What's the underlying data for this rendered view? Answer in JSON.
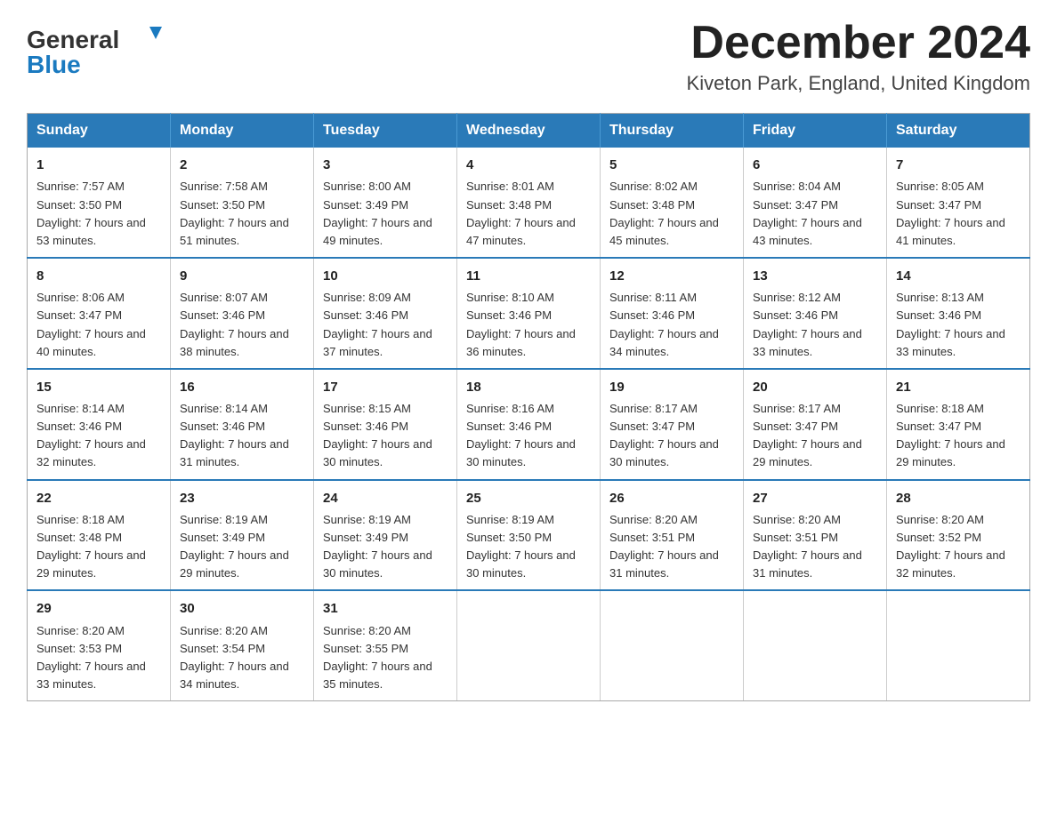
{
  "header": {
    "logo_general": "General",
    "logo_blue": "Blue",
    "month_title": "December 2024",
    "location": "Kiveton Park, England, United Kingdom"
  },
  "weekdays": [
    "Sunday",
    "Monday",
    "Tuesday",
    "Wednesday",
    "Thursday",
    "Friday",
    "Saturday"
  ],
  "weeks": [
    [
      {
        "day": "1",
        "sunrise": "7:57 AM",
        "sunset": "3:50 PM",
        "daylight": "7 hours and 53 minutes."
      },
      {
        "day": "2",
        "sunrise": "7:58 AM",
        "sunset": "3:50 PM",
        "daylight": "7 hours and 51 minutes."
      },
      {
        "day": "3",
        "sunrise": "8:00 AM",
        "sunset": "3:49 PM",
        "daylight": "7 hours and 49 minutes."
      },
      {
        "day": "4",
        "sunrise": "8:01 AM",
        "sunset": "3:48 PM",
        "daylight": "7 hours and 47 minutes."
      },
      {
        "day": "5",
        "sunrise": "8:02 AM",
        "sunset": "3:48 PM",
        "daylight": "7 hours and 45 minutes."
      },
      {
        "day": "6",
        "sunrise": "8:04 AM",
        "sunset": "3:47 PM",
        "daylight": "7 hours and 43 minutes."
      },
      {
        "day": "7",
        "sunrise": "8:05 AM",
        "sunset": "3:47 PM",
        "daylight": "7 hours and 41 minutes."
      }
    ],
    [
      {
        "day": "8",
        "sunrise": "8:06 AM",
        "sunset": "3:47 PM",
        "daylight": "7 hours and 40 minutes."
      },
      {
        "day": "9",
        "sunrise": "8:07 AM",
        "sunset": "3:46 PM",
        "daylight": "7 hours and 38 minutes."
      },
      {
        "day": "10",
        "sunrise": "8:09 AM",
        "sunset": "3:46 PM",
        "daylight": "7 hours and 37 minutes."
      },
      {
        "day": "11",
        "sunrise": "8:10 AM",
        "sunset": "3:46 PM",
        "daylight": "7 hours and 36 minutes."
      },
      {
        "day": "12",
        "sunrise": "8:11 AM",
        "sunset": "3:46 PM",
        "daylight": "7 hours and 34 minutes."
      },
      {
        "day": "13",
        "sunrise": "8:12 AM",
        "sunset": "3:46 PM",
        "daylight": "7 hours and 33 minutes."
      },
      {
        "day": "14",
        "sunrise": "8:13 AM",
        "sunset": "3:46 PM",
        "daylight": "7 hours and 33 minutes."
      }
    ],
    [
      {
        "day": "15",
        "sunrise": "8:14 AM",
        "sunset": "3:46 PM",
        "daylight": "7 hours and 32 minutes."
      },
      {
        "day": "16",
        "sunrise": "8:14 AM",
        "sunset": "3:46 PM",
        "daylight": "7 hours and 31 minutes."
      },
      {
        "day": "17",
        "sunrise": "8:15 AM",
        "sunset": "3:46 PM",
        "daylight": "7 hours and 30 minutes."
      },
      {
        "day": "18",
        "sunrise": "8:16 AM",
        "sunset": "3:46 PM",
        "daylight": "7 hours and 30 minutes."
      },
      {
        "day": "19",
        "sunrise": "8:17 AM",
        "sunset": "3:47 PM",
        "daylight": "7 hours and 30 minutes."
      },
      {
        "day": "20",
        "sunrise": "8:17 AM",
        "sunset": "3:47 PM",
        "daylight": "7 hours and 29 minutes."
      },
      {
        "day": "21",
        "sunrise": "8:18 AM",
        "sunset": "3:47 PM",
        "daylight": "7 hours and 29 minutes."
      }
    ],
    [
      {
        "day": "22",
        "sunrise": "8:18 AM",
        "sunset": "3:48 PM",
        "daylight": "7 hours and 29 minutes."
      },
      {
        "day": "23",
        "sunrise": "8:19 AM",
        "sunset": "3:49 PM",
        "daylight": "7 hours and 29 minutes."
      },
      {
        "day": "24",
        "sunrise": "8:19 AM",
        "sunset": "3:49 PM",
        "daylight": "7 hours and 30 minutes."
      },
      {
        "day": "25",
        "sunrise": "8:19 AM",
        "sunset": "3:50 PM",
        "daylight": "7 hours and 30 minutes."
      },
      {
        "day": "26",
        "sunrise": "8:20 AM",
        "sunset": "3:51 PM",
        "daylight": "7 hours and 31 minutes."
      },
      {
        "day": "27",
        "sunrise": "8:20 AM",
        "sunset": "3:51 PM",
        "daylight": "7 hours and 31 minutes."
      },
      {
        "day": "28",
        "sunrise": "8:20 AM",
        "sunset": "3:52 PM",
        "daylight": "7 hours and 32 minutes."
      }
    ],
    [
      {
        "day": "29",
        "sunrise": "8:20 AM",
        "sunset": "3:53 PM",
        "daylight": "7 hours and 33 minutes."
      },
      {
        "day": "30",
        "sunrise": "8:20 AM",
        "sunset": "3:54 PM",
        "daylight": "7 hours and 34 minutes."
      },
      {
        "day": "31",
        "sunrise": "8:20 AM",
        "sunset": "3:55 PM",
        "daylight": "7 hours and 35 minutes."
      },
      null,
      null,
      null,
      null
    ]
  ]
}
